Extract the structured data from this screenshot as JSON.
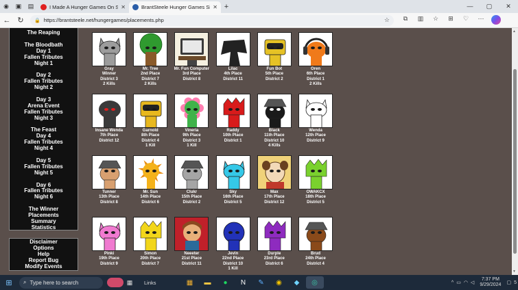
{
  "browser": {
    "tabs": [
      {
        "title": "I Made A Hunger Games On Spru",
        "favicon": "#e02020",
        "active": false
      },
      {
        "title": "BrantSteele Hunger Games Simul",
        "favicon": "#2b5ea8",
        "active": true
      }
    ],
    "url": "https://brantsteele.net/hungergames/placements.php"
  },
  "sidebar": {
    "groups": [
      [
        "The Reaping"
      ],
      [
        "The Bloodbath",
        "Day 1",
        "Fallen Tributes",
        "Night 1"
      ],
      [
        "Day 2",
        "Fallen Tributes",
        "Night 2"
      ],
      [
        "Day 3",
        "Arena Event",
        "Fallen Tributes",
        "Night 3"
      ],
      [
        "The Feast",
        "Day 4",
        "Fallen Tributes",
        "Night 4"
      ],
      [
        "Day 5",
        "Fallen Tributes",
        "Night 5"
      ],
      [
        "Day 6",
        "Fallen Tributes",
        "Night 6"
      ],
      [
        "The Winner",
        "Placements",
        "Summary",
        "Statistics"
      ]
    ],
    "current": "Placements",
    "bottom": [
      "Disclaimer",
      "Options",
      "Help",
      "Report Bug",
      "Modify Events"
    ]
  },
  "tributes": [
    {
      "name": "Gray",
      "place": "Winner",
      "district": "District 3",
      "kills": "2 Kills",
      "color": "#9c9c9c",
      "bg": "#ffffff",
      "shape": "cat",
      "face": "dark"
    },
    {
      "name": "Mr. Tree",
      "place": "2nd Place",
      "district": "District 7",
      "kills": "2 Kills",
      "color": "#2f9a2f",
      "bg": "#ffffff",
      "shape": "tree",
      "face": "dark"
    },
    {
      "name": "Mr. Fun Computer",
      "place": "3rd Place",
      "district": "District 8",
      "kills": "",
      "color": "#3a3a3a",
      "bg": "#f5f0e0",
      "shape": "computer",
      "face": "light"
    },
    {
      "name": "Lilac",
      "place": "4th Place",
      "district": "District 11",
      "kills": "",
      "color": "#222222",
      "bg": "#ffffff",
      "shape": "ink",
      "face": "light"
    },
    {
      "name": "Fun Bot",
      "place": "5th Place",
      "district": "District 2",
      "kills": "",
      "color": "#e6c225",
      "bg": "#ffffff",
      "shape": "bot",
      "face": "dark"
    },
    {
      "name": "Oren",
      "place": "6th Place",
      "district": "District 1",
      "kills": "2 Kills",
      "color": "#f07a1a",
      "bg": "#ffffff",
      "shape": "headphones",
      "face": "dark"
    },
    {
      "name": "Insane Wenda",
      "place": "7th Place",
      "district": "District 12",
      "kills": "",
      "color": "#3a3a3a",
      "bg": "#ffffff",
      "shape": "dark",
      "face": "red"
    },
    {
      "name": "Garnold",
      "place": "8th Place",
      "district": "District 4",
      "kills": "1 Kill",
      "color": "#e8b81e",
      "bg": "#ffffff",
      "shape": "bot",
      "face": "dark"
    },
    {
      "name": "Vineria",
      "place": "9th Place",
      "district": "District 3",
      "kills": "1 Kill",
      "color": "#3fb34a",
      "bg": "#ffffff",
      "shape": "flower",
      "face": "dark"
    },
    {
      "name": "Raddy",
      "place": "10th Place",
      "district": "District 1",
      "kills": "",
      "color": "#d81b1b",
      "bg": "#ffffff",
      "shape": "spiky",
      "face": "dark"
    },
    {
      "name": "Black",
      "place": "11th Place",
      "district": "District 10",
      "kills": "4 Kills",
      "color": "#1a1a1a",
      "bg": "#ffffff",
      "shape": "hat",
      "face": "light"
    },
    {
      "name": "Wenda",
      "place": "12th Place",
      "district": "District 9",
      "kills": "",
      "color": "#ffffff",
      "bg": "#ffffff",
      "shape": "cat",
      "face": "dark"
    },
    {
      "name": "Tunner",
      "place": "13th Place",
      "district": "District 8",
      "kills": "",
      "color": "#d8a070",
      "bg": "#ffffff",
      "shape": "hat",
      "face": "dark"
    },
    {
      "name": "Mr. Sun",
      "place": "14th Place",
      "district": "District 6",
      "kills": "",
      "color": "#f4b21a",
      "bg": "#ffffff",
      "shape": "sun",
      "face": "dark"
    },
    {
      "name": "Clukr",
      "place": "15th Place",
      "district": "District 2",
      "kills": "",
      "color": "#a5a5a5",
      "bg": "#ffffff",
      "shape": "hat",
      "face": "dark"
    },
    {
      "name": "Sky",
      "place": "16th Place",
      "district": "District 5",
      "kills": "",
      "color": "#35c8e8",
      "bg": "#ffffff",
      "shape": "cat",
      "face": "dark"
    },
    {
      "name": "Max",
      "place": "17th Place",
      "district": "District 12",
      "kills": "",
      "color": "#c0392b",
      "bg": "#f0d27a",
      "shape": "max",
      "face": "dark"
    },
    {
      "name": "OWAKCX",
      "place": "18th Place",
      "district": "District 5",
      "kills": "",
      "color": "#7ad12e",
      "bg": "#ffffff",
      "shape": "spiky",
      "face": "dark"
    },
    {
      "name": "Pinki",
      "place": "19th Place",
      "district": "District 9",
      "kills": "",
      "color": "#f07ad0",
      "bg": "#ffffff",
      "shape": "cat",
      "face": "dark"
    },
    {
      "name": "Simon",
      "place": "20th Place",
      "district": "District 7",
      "kills": "",
      "color": "#f2d61a",
      "bg": "#ffffff",
      "shape": "spiky",
      "face": "dark"
    },
    {
      "name": "Neeeter",
      "place": "21st Place",
      "district": "District 11",
      "kills": "",
      "color": "#e8b07a",
      "bg": "#c0202a",
      "shape": "human",
      "face": "dark"
    },
    {
      "name": "Jevin",
      "place": "22nd Place",
      "district": "District 10",
      "kills": "1 Kill",
      "color": "#2232b8",
      "bg": "#ffffff",
      "shape": "round",
      "face": "dark"
    },
    {
      "name": "Durple",
      "place": "23rd Place",
      "district": "District 6",
      "kills": "",
      "color": "#8e2bbf",
      "bg": "#ffffff",
      "shape": "spiky",
      "face": "dark"
    },
    {
      "name": "Brud",
      "place": "24th Place",
      "district": "District 4",
      "kills": "",
      "color": "#8a4a1a",
      "bg": "#ffffff",
      "shape": "hat",
      "face": "dark"
    }
  ],
  "taskbar": {
    "search_placeholder": "Type here to search",
    "links_label": "Links",
    "time": "7:37 PM",
    "date": "9/29/2024",
    "notification_count": "5"
  }
}
